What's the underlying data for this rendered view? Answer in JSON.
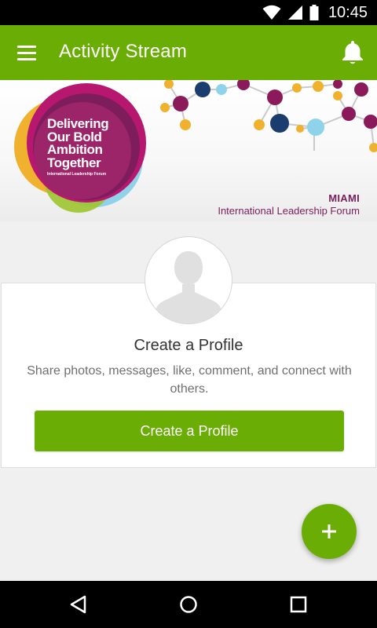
{
  "status_bar": {
    "time": "10:45",
    "icons": [
      "wifi-icon",
      "signal-icon",
      "battery-icon"
    ]
  },
  "app_bar": {
    "title": "Activity Stream",
    "menu_icon": "hamburger-menu-icon",
    "notification_icon": "bell-icon",
    "color": "#6aad05"
  },
  "banner": {
    "logo_lines": [
      "Delivering",
      "Our Bold",
      "Ambition",
      "Together"
    ],
    "logo_subtitle": "International Leadership Forum",
    "city": "MIAMI",
    "forum": "International Leadership Forum",
    "text_color": "#7a1d5b"
  },
  "profile_card": {
    "avatar_icon": "default-avatar-icon",
    "title": "Create a Profile",
    "description": "Share photos, messages, like, comment, and connect with others.",
    "button_label": "Create a Profile"
  },
  "fab": {
    "icon": "plus-icon"
  },
  "nav_bar": {
    "icons": [
      "back-icon",
      "home-icon",
      "recents-icon"
    ]
  }
}
